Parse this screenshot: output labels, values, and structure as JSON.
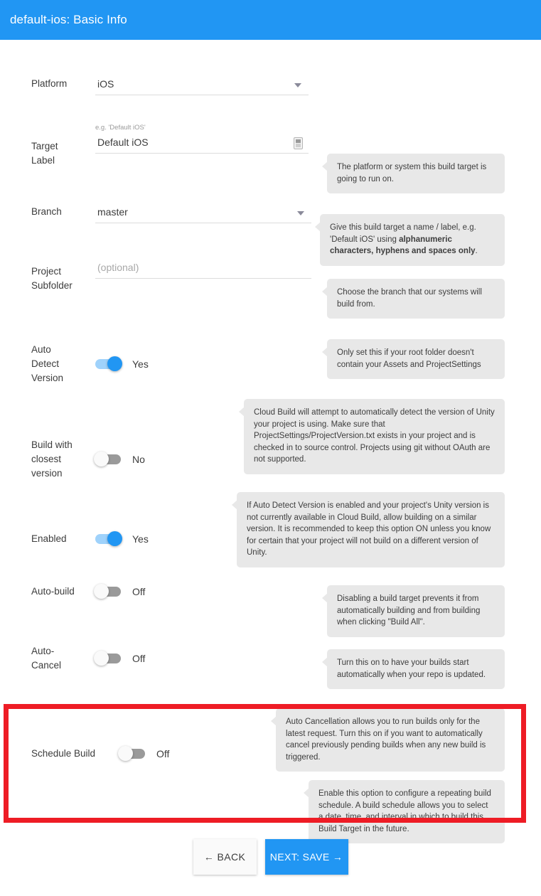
{
  "header": {
    "title": "default-ios: Basic Info"
  },
  "fields": {
    "platform": {
      "label": "Platform",
      "value": "iOS",
      "icon": "chevron-down-icon",
      "tip": "The platform or system this build target is going to run on."
    },
    "target_label": {
      "label": "Target Label",
      "hint": "e.g. 'Default iOS'",
      "value": "Default iOS",
      "icon": "spinner-icon",
      "tip_prefix": "Give this build target a name / label, e.g. 'Default iOS' using ",
      "tip_bold": "alphanumeric characters, hyphens and spaces only",
      "tip_suffix": "."
    },
    "branch": {
      "label": "Branch",
      "value": "master",
      "icon": "chevron-down-icon",
      "tip": "Choose the branch that our systems will build from."
    },
    "project_subfolder": {
      "label": "Project Subfolder",
      "placeholder": "(optional)",
      "tip": "Only set this if your root folder doesn't contain your Assets and ProjectSettings"
    },
    "auto_detect_version": {
      "label": "Auto Detect Version",
      "state": "on",
      "state_text": "Yes",
      "tip": "Cloud Build will attempt to automatically detect the version of Unity your project is using. Make sure that ProjectSettings/ProjectVersion.txt exists in your project and is checked in to source control. Projects using git without OAuth are not supported."
    },
    "build_closest_version": {
      "label": "Build with closest version",
      "state": "off",
      "state_text": "No",
      "tip": "If Auto Detect Version is enabled and your project's Unity version is not currently available in Cloud Build, allow building on a similar version. It is recommended to keep this option ON unless you know for certain that your project will not build on a different version of Unity."
    },
    "enabled": {
      "label": "Enabled",
      "state": "on",
      "state_text": "Yes",
      "tip": "Disabling a build target prevents it from automatically building and from building when clicking \"Build All\"."
    },
    "auto_build": {
      "label": "Auto-build",
      "state": "off",
      "state_text": "Off",
      "tip": "Turn this on to have your builds start automatically when your repo is updated."
    },
    "auto_cancel": {
      "label": "Auto-Cancel",
      "state": "off",
      "state_text": "Off",
      "tip": "Auto Cancellation allows you to run builds only for the latest request. Turn this on if you want to automatically cancel previously pending builds when any new build is triggered."
    },
    "schedule_build": {
      "label": "Schedule Build",
      "state": "off",
      "state_text": "Off",
      "tip": "Enable this option to configure a repeating build schedule. A build schedule allows you to select a date, time, and interval in which to build this Build Target in the future."
    }
  },
  "footer": {
    "back_label": "← BACK",
    "next_label": "NEXT: SAVE →"
  },
  "colors": {
    "accent": "#2196f3",
    "highlight": "#ee1c25",
    "tooltip_bg": "#e8e8e8",
    "toggle_on_track": "#9fd2fb",
    "toggle_off_track": "#9a9a9a"
  }
}
